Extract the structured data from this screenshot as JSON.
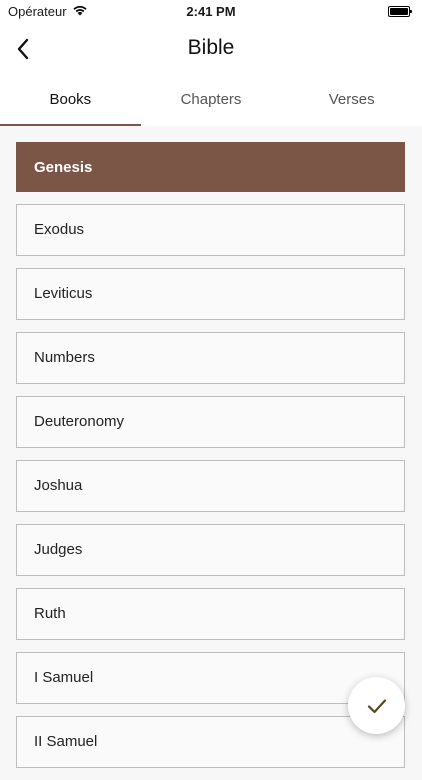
{
  "status_bar": {
    "carrier": "Opérateur",
    "time": "2:41 PM"
  },
  "nav": {
    "title": "Bible"
  },
  "tabs": [
    {
      "label": "Books",
      "active": true
    },
    {
      "label": "Chapters",
      "active": false
    },
    {
      "label": "Verses",
      "active": false
    }
  ],
  "books": [
    {
      "name": "Genesis",
      "selected": true
    },
    {
      "name": "Exodus"
    },
    {
      "name": "Leviticus"
    },
    {
      "name": "Numbers"
    },
    {
      "name": "Deuteronomy"
    },
    {
      "name": "Joshua"
    },
    {
      "name": "Judges"
    },
    {
      "name": "Ruth"
    },
    {
      "name": "I Samuel"
    },
    {
      "name": "II Samuel"
    }
  ],
  "colors": {
    "accent": "#7b5546",
    "fab_check": "#5a4a1e"
  },
  "icons": {
    "back": "chevron-left-icon",
    "wifi": "wifi-icon",
    "battery": "battery-icon",
    "confirm": "checkmark-icon"
  }
}
